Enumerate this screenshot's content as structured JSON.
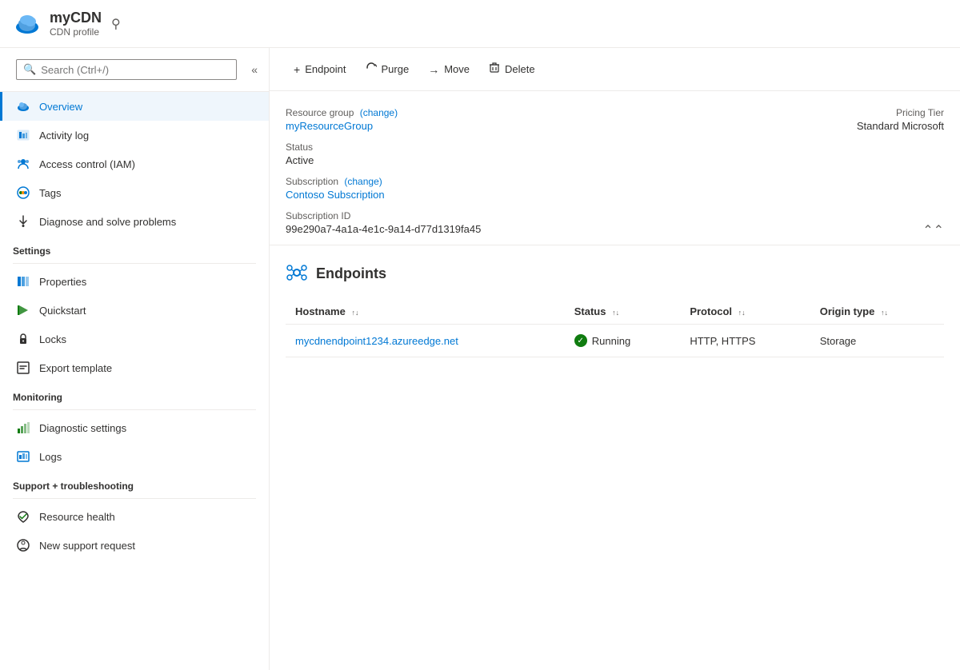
{
  "header": {
    "title": "myCDN",
    "subtitle": "CDN profile",
    "pin_label": "📌"
  },
  "sidebar": {
    "search_placeholder": "Search (Ctrl+/)",
    "collapse_label": "«",
    "nav_items": [
      {
        "id": "overview",
        "label": "Overview",
        "active": true,
        "icon": "cloud"
      },
      {
        "id": "activity-log",
        "label": "Activity log",
        "active": false,
        "icon": "activity"
      },
      {
        "id": "access-control",
        "label": "Access control (IAM)",
        "active": false,
        "icon": "iam"
      },
      {
        "id": "tags",
        "label": "Tags",
        "active": false,
        "icon": "tags"
      },
      {
        "id": "diagnose",
        "label": "Diagnose and solve problems",
        "active": false,
        "icon": "wrench"
      }
    ],
    "sections": [
      {
        "title": "Settings",
        "items": [
          {
            "id": "properties",
            "label": "Properties",
            "icon": "properties"
          },
          {
            "id": "quickstart",
            "label": "Quickstart",
            "icon": "quickstart"
          },
          {
            "id": "locks",
            "label": "Locks",
            "icon": "locks"
          },
          {
            "id": "export-template",
            "label": "Export template",
            "icon": "export"
          }
        ]
      },
      {
        "title": "Monitoring",
        "items": [
          {
            "id": "diagnostic-settings",
            "label": "Diagnostic settings",
            "icon": "diagnostic"
          },
          {
            "id": "logs",
            "label": "Logs",
            "icon": "logs"
          }
        ]
      },
      {
        "title": "Support + troubleshooting",
        "items": [
          {
            "id": "resource-health",
            "label": "Resource health",
            "icon": "health"
          },
          {
            "id": "new-support-request",
            "label": "New support request",
            "icon": "support"
          }
        ]
      }
    ]
  },
  "toolbar": {
    "buttons": [
      {
        "id": "endpoint",
        "label": "Endpoint",
        "icon": "+"
      },
      {
        "id": "purge",
        "label": "Purge",
        "icon": "↻"
      },
      {
        "id": "move",
        "label": "Move",
        "icon": "→"
      },
      {
        "id": "delete",
        "label": "Delete",
        "icon": "🗑"
      }
    ]
  },
  "info": {
    "resource_group_label": "Resource group",
    "resource_group_change": "(change)",
    "resource_group_value": "myResourceGroup",
    "status_label": "Status",
    "status_value": "Active",
    "subscription_label": "Subscription",
    "subscription_change": "(change)",
    "subscription_value": "Contoso Subscription",
    "subscription_id_label": "Subscription ID",
    "subscription_id_value": "99e290a7-4a1a-4e1c-9a14-d77d1319fa45",
    "pricing_tier_label": "Pricing Tier",
    "pricing_tier_value": "Standard Microsoft"
  },
  "endpoints": {
    "title": "Endpoints",
    "columns": [
      "Hostname",
      "Status",
      "Protocol",
      "Origin type"
    ],
    "rows": [
      {
        "hostname": "mycdnendpoint1234.azureedge.net",
        "status": "Running",
        "protocol": "HTTP, HTTPS",
        "origin_type": "Storage"
      }
    ]
  }
}
